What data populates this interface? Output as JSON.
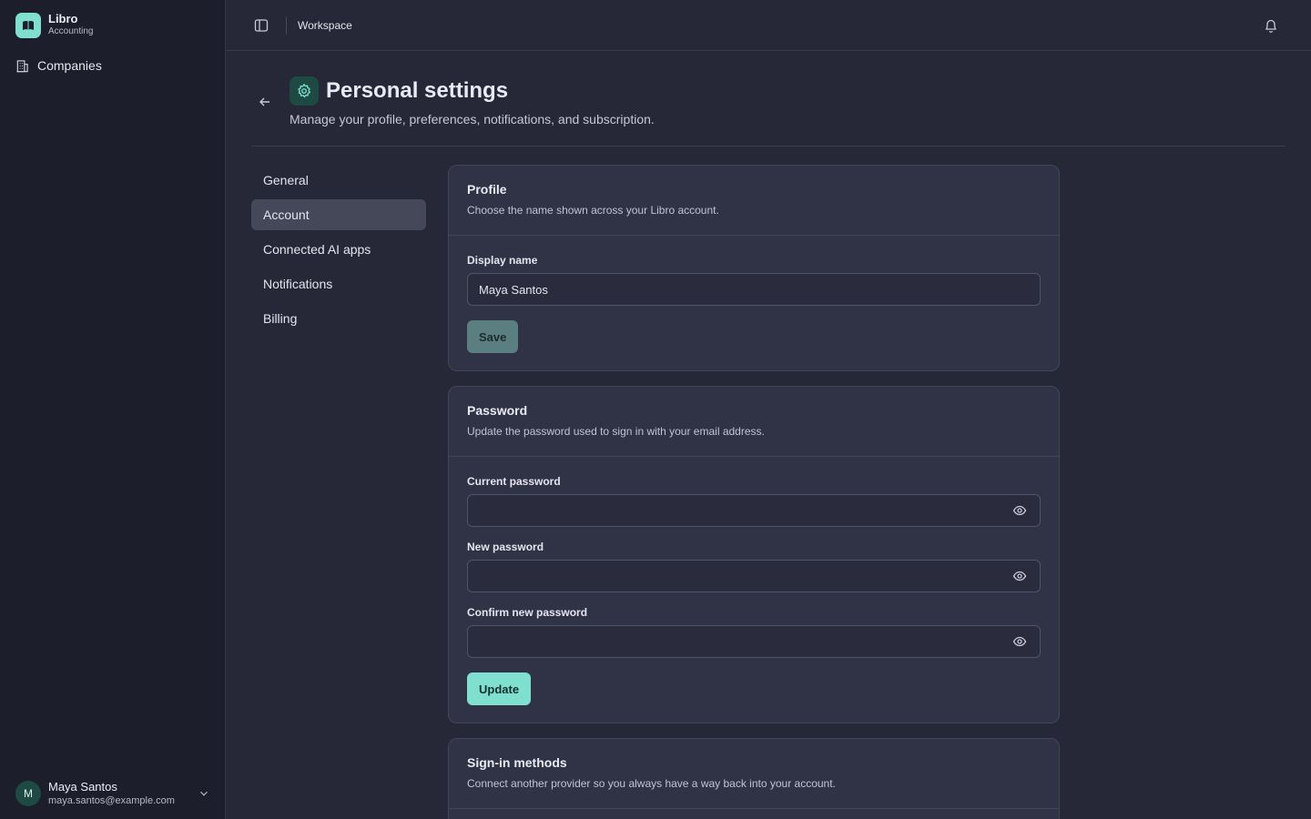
{
  "app": {
    "name": "Libro",
    "subtitle": "Accounting"
  },
  "sidebar": {
    "items": [
      {
        "label": "Companies",
        "icon": "building-icon"
      }
    ]
  },
  "user": {
    "initial": "M",
    "name": "Maya Santos",
    "email": "maya.santos@example.com"
  },
  "topbar": {
    "breadcrumb": "Workspace"
  },
  "header": {
    "title": "Personal settings",
    "subtitle": "Manage your profile, preferences, notifications, and subscription."
  },
  "settings_nav": {
    "items": [
      {
        "label": "General",
        "active": false
      },
      {
        "label": "Account",
        "active": true
      },
      {
        "label": "Connected AI apps",
        "active": false
      },
      {
        "label": "Notifications",
        "active": false
      },
      {
        "label": "Billing",
        "active": false
      }
    ]
  },
  "profile": {
    "title": "Profile",
    "description": "Choose the name shown across your Libro account.",
    "display_name_label": "Display name",
    "display_name_value": "Maya Santos",
    "save_label": "Save"
  },
  "password": {
    "title": "Password",
    "description": "Update the password used to sign in with your email address.",
    "current_label": "Current password",
    "new_label": "New password",
    "confirm_label": "Confirm new password",
    "update_label": "Update"
  },
  "signin": {
    "title": "Sign-in methods",
    "description": "Connect another provider so you always have a way back into your account."
  },
  "colors": {
    "accent": "#7fe0d0",
    "sidebar_bg": "#1c1e2c",
    "main_bg": "#262838",
    "card_bg": "#303245"
  }
}
